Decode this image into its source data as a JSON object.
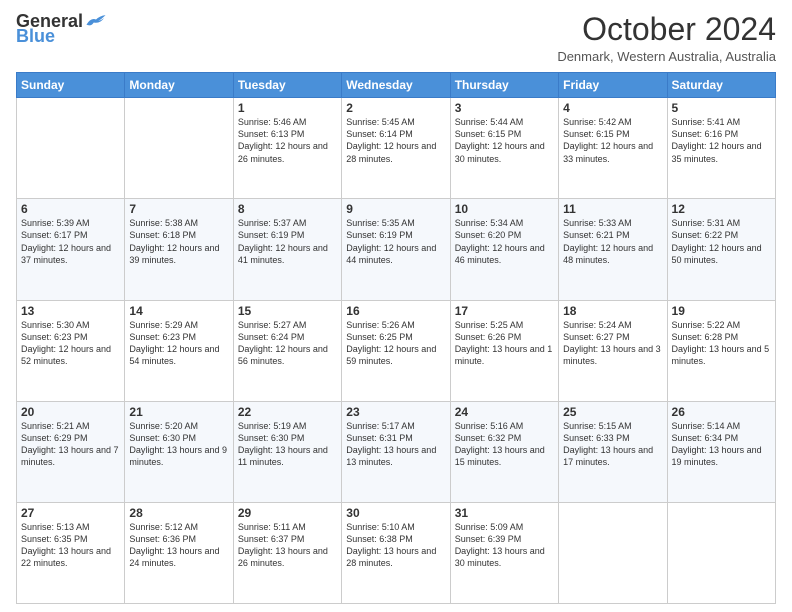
{
  "header": {
    "logo_general": "General",
    "logo_blue": "Blue",
    "month_title": "October 2024",
    "subtitle": "Denmark, Western Australia, Australia"
  },
  "days_of_week": [
    "Sunday",
    "Monday",
    "Tuesday",
    "Wednesday",
    "Thursday",
    "Friday",
    "Saturday"
  ],
  "weeks": [
    [
      {
        "day": "",
        "info": ""
      },
      {
        "day": "",
        "info": ""
      },
      {
        "day": "1",
        "info": "Sunrise: 5:46 AM\nSunset: 6:13 PM\nDaylight: 12 hours and 26 minutes."
      },
      {
        "day": "2",
        "info": "Sunrise: 5:45 AM\nSunset: 6:14 PM\nDaylight: 12 hours and 28 minutes."
      },
      {
        "day": "3",
        "info": "Sunrise: 5:44 AM\nSunset: 6:15 PM\nDaylight: 12 hours and 30 minutes."
      },
      {
        "day": "4",
        "info": "Sunrise: 5:42 AM\nSunset: 6:15 PM\nDaylight: 12 hours and 33 minutes."
      },
      {
        "day": "5",
        "info": "Sunrise: 5:41 AM\nSunset: 6:16 PM\nDaylight: 12 hours and 35 minutes."
      }
    ],
    [
      {
        "day": "6",
        "info": "Sunrise: 5:39 AM\nSunset: 6:17 PM\nDaylight: 12 hours and 37 minutes."
      },
      {
        "day": "7",
        "info": "Sunrise: 5:38 AM\nSunset: 6:18 PM\nDaylight: 12 hours and 39 minutes."
      },
      {
        "day": "8",
        "info": "Sunrise: 5:37 AM\nSunset: 6:19 PM\nDaylight: 12 hours and 41 minutes."
      },
      {
        "day": "9",
        "info": "Sunrise: 5:35 AM\nSunset: 6:19 PM\nDaylight: 12 hours and 44 minutes."
      },
      {
        "day": "10",
        "info": "Sunrise: 5:34 AM\nSunset: 6:20 PM\nDaylight: 12 hours and 46 minutes."
      },
      {
        "day": "11",
        "info": "Sunrise: 5:33 AM\nSunset: 6:21 PM\nDaylight: 12 hours and 48 minutes."
      },
      {
        "day": "12",
        "info": "Sunrise: 5:31 AM\nSunset: 6:22 PM\nDaylight: 12 hours and 50 minutes."
      }
    ],
    [
      {
        "day": "13",
        "info": "Sunrise: 5:30 AM\nSunset: 6:23 PM\nDaylight: 12 hours and 52 minutes."
      },
      {
        "day": "14",
        "info": "Sunrise: 5:29 AM\nSunset: 6:23 PM\nDaylight: 12 hours and 54 minutes."
      },
      {
        "day": "15",
        "info": "Sunrise: 5:27 AM\nSunset: 6:24 PM\nDaylight: 12 hours and 56 minutes."
      },
      {
        "day": "16",
        "info": "Sunrise: 5:26 AM\nSunset: 6:25 PM\nDaylight: 12 hours and 59 minutes."
      },
      {
        "day": "17",
        "info": "Sunrise: 5:25 AM\nSunset: 6:26 PM\nDaylight: 13 hours and 1 minute."
      },
      {
        "day": "18",
        "info": "Sunrise: 5:24 AM\nSunset: 6:27 PM\nDaylight: 13 hours and 3 minutes."
      },
      {
        "day": "19",
        "info": "Sunrise: 5:22 AM\nSunset: 6:28 PM\nDaylight: 13 hours and 5 minutes."
      }
    ],
    [
      {
        "day": "20",
        "info": "Sunrise: 5:21 AM\nSunset: 6:29 PM\nDaylight: 13 hours and 7 minutes."
      },
      {
        "day": "21",
        "info": "Sunrise: 5:20 AM\nSunset: 6:30 PM\nDaylight: 13 hours and 9 minutes."
      },
      {
        "day": "22",
        "info": "Sunrise: 5:19 AM\nSunset: 6:30 PM\nDaylight: 13 hours and 11 minutes."
      },
      {
        "day": "23",
        "info": "Sunrise: 5:17 AM\nSunset: 6:31 PM\nDaylight: 13 hours and 13 minutes."
      },
      {
        "day": "24",
        "info": "Sunrise: 5:16 AM\nSunset: 6:32 PM\nDaylight: 13 hours and 15 minutes."
      },
      {
        "day": "25",
        "info": "Sunrise: 5:15 AM\nSunset: 6:33 PM\nDaylight: 13 hours and 17 minutes."
      },
      {
        "day": "26",
        "info": "Sunrise: 5:14 AM\nSunset: 6:34 PM\nDaylight: 13 hours and 19 minutes."
      }
    ],
    [
      {
        "day": "27",
        "info": "Sunrise: 5:13 AM\nSunset: 6:35 PM\nDaylight: 13 hours and 22 minutes."
      },
      {
        "day": "28",
        "info": "Sunrise: 5:12 AM\nSunset: 6:36 PM\nDaylight: 13 hours and 24 minutes."
      },
      {
        "day": "29",
        "info": "Sunrise: 5:11 AM\nSunset: 6:37 PM\nDaylight: 13 hours and 26 minutes."
      },
      {
        "day": "30",
        "info": "Sunrise: 5:10 AM\nSunset: 6:38 PM\nDaylight: 13 hours and 28 minutes."
      },
      {
        "day": "31",
        "info": "Sunrise: 5:09 AM\nSunset: 6:39 PM\nDaylight: 13 hours and 30 minutes."
      },
      {
        "day": "",
        "info": ""
      },
      {
        "day": "",
        "info": ""
      }
    ]
  ]
}
